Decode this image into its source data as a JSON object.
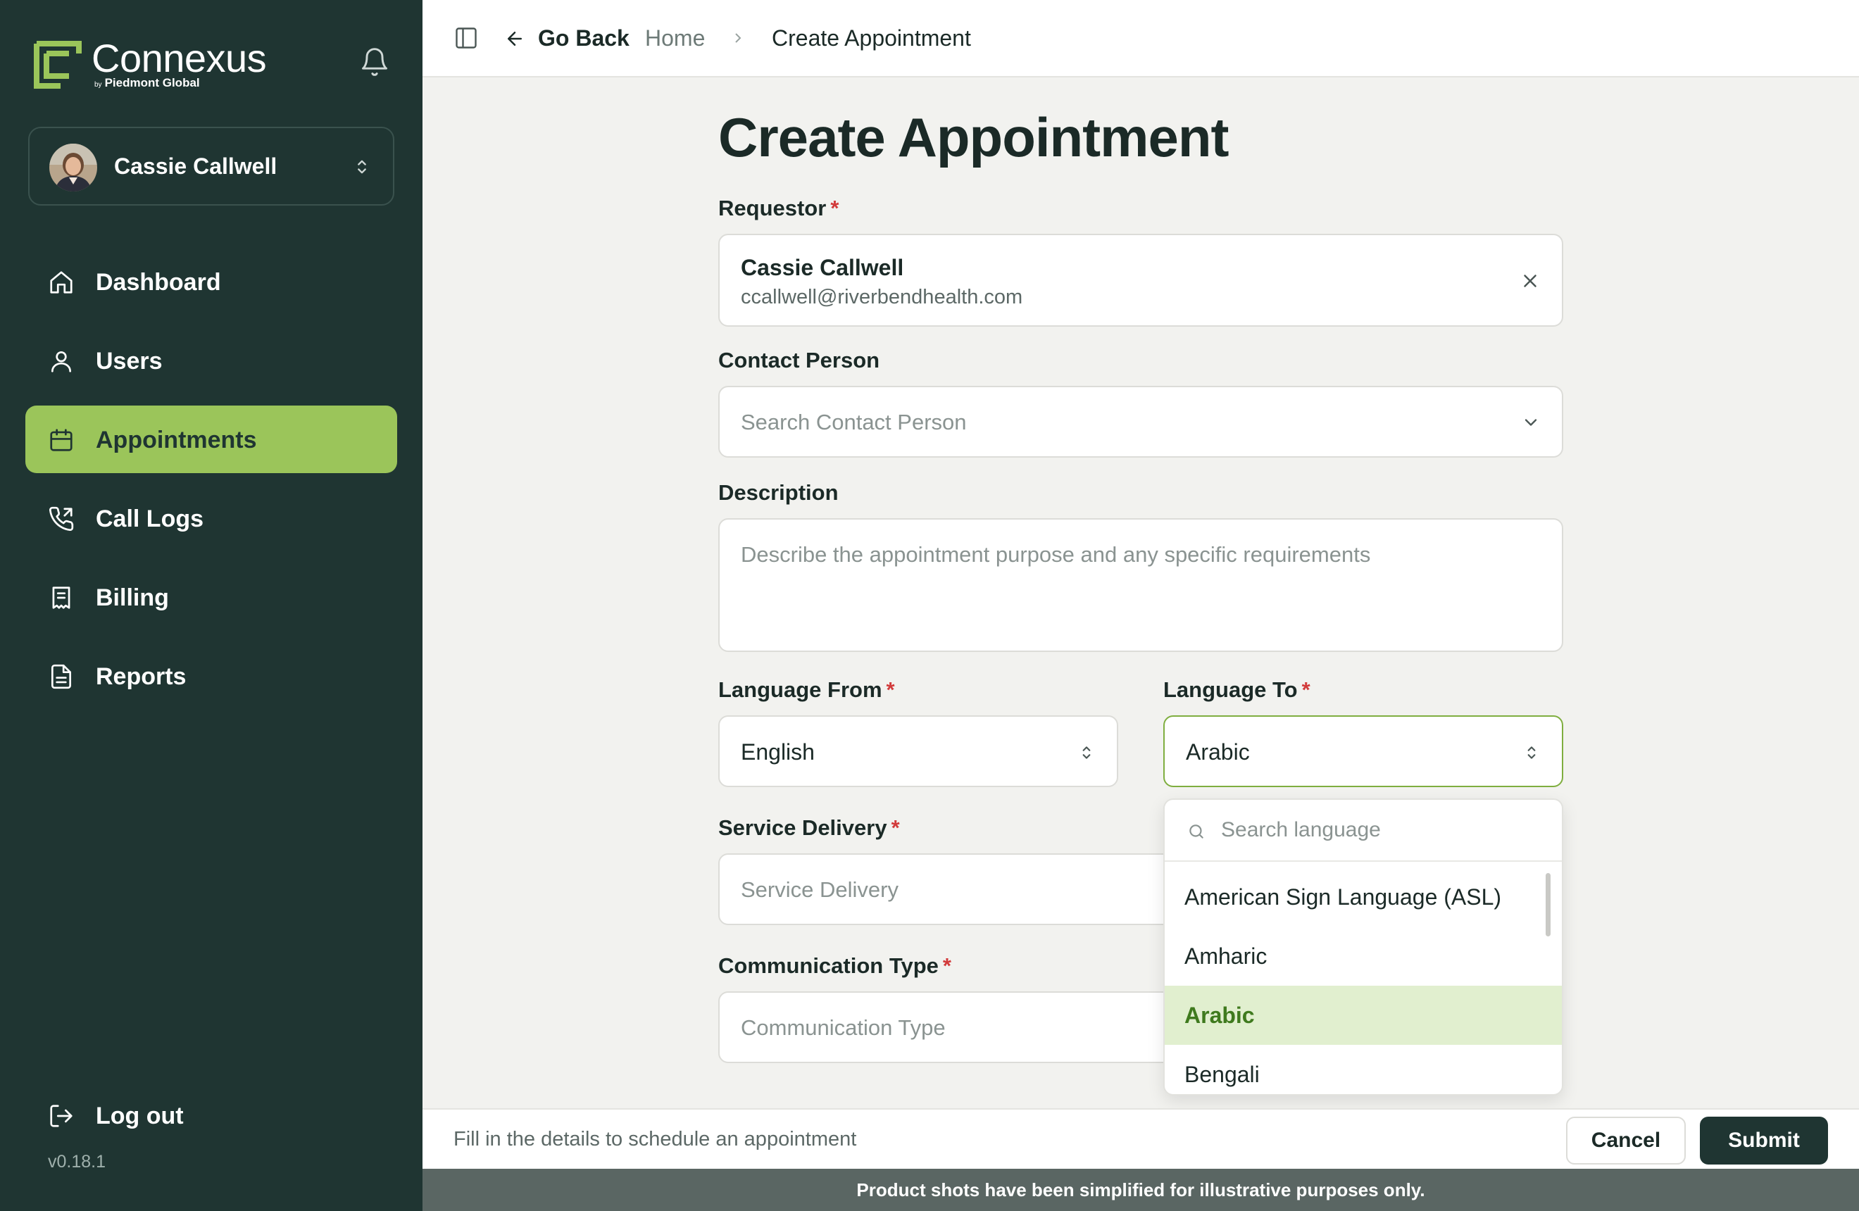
{
  "brand": {
    "name": "Connexus",
    "by": "by",
    "sub": "Piedmont Global",
    "accent": "#9bc55a",
    "sidebar_bg": "#1f3532"
  },
  "user": {
    "name": "Cassie Callwell"
  },
  "nav": {
    "items": [
      {
        "label": "Dashboard",
        "icon": "home-icon"
      },
      {
        "label": "Users",
        "icon": "user-icon"
      },
      {
        "label": "Appointments",
        "icon": "calendar-icon",
        "active": true
      },
      {
        "label": "Call Logs",
        "icon": "phone-icon"
      },
      {
        "label": "Billing",
        "icon": "receipt-icon"
      },
      {
        "label": "Reports",
        "icon": "file-icon"
      }
    ],
    "logout": "Log out",
    "version": "v0.18.1"
  },
  "topbar": {
    "go_back": "Go Back",
    "breadcrumb": [
      "Home",
      "Create Appointment"
    ]
  },
  "form": {
    "title": "Create Appointment",
    "requestor": {
      "label": "Requestor",
      "name": "Cassie Callwell",
      "email": "ccallwell@riverbendhealth.com"
    },
    "contact_person": {
      "label": "Contact Person",
      "placeholder": "Search Contact Person"
    },
    "description": {
      "label": "Description",
      "placeholder": "Describe the appointment purpose and any specific requirements"
    },
    "language_from": {
      "label": "Language From",
      "value": "English"
    },
    "language_to": {
      "label": "Language To",
      "value": "Arabic"
    },
    "service_delivery": {
      "label": "Service Delivery",
      "placeholder": "Service Delivery"
    },
    "communication_type": {
      "label": "Communication Type",
      "placeholder": "Communication Type"
    },
    "required_marker": "*"
  },
  "language_dropdown": {
    "search_placeholder": "Search language",
    "options": [
      "American Sign Language (ASL)",
      "Amharic",
      "Arabic",
      "Bengali"
    ],
    "selected": "Arabic"
  },
  "footer": {
    "hint": "Fill in the details to schedule an appointment",
    "cancel": "Cancel",
    "submit": "Submit"
  },
  "disclaimer": "Product shots have been simplified for illustrative purposes only."
}
